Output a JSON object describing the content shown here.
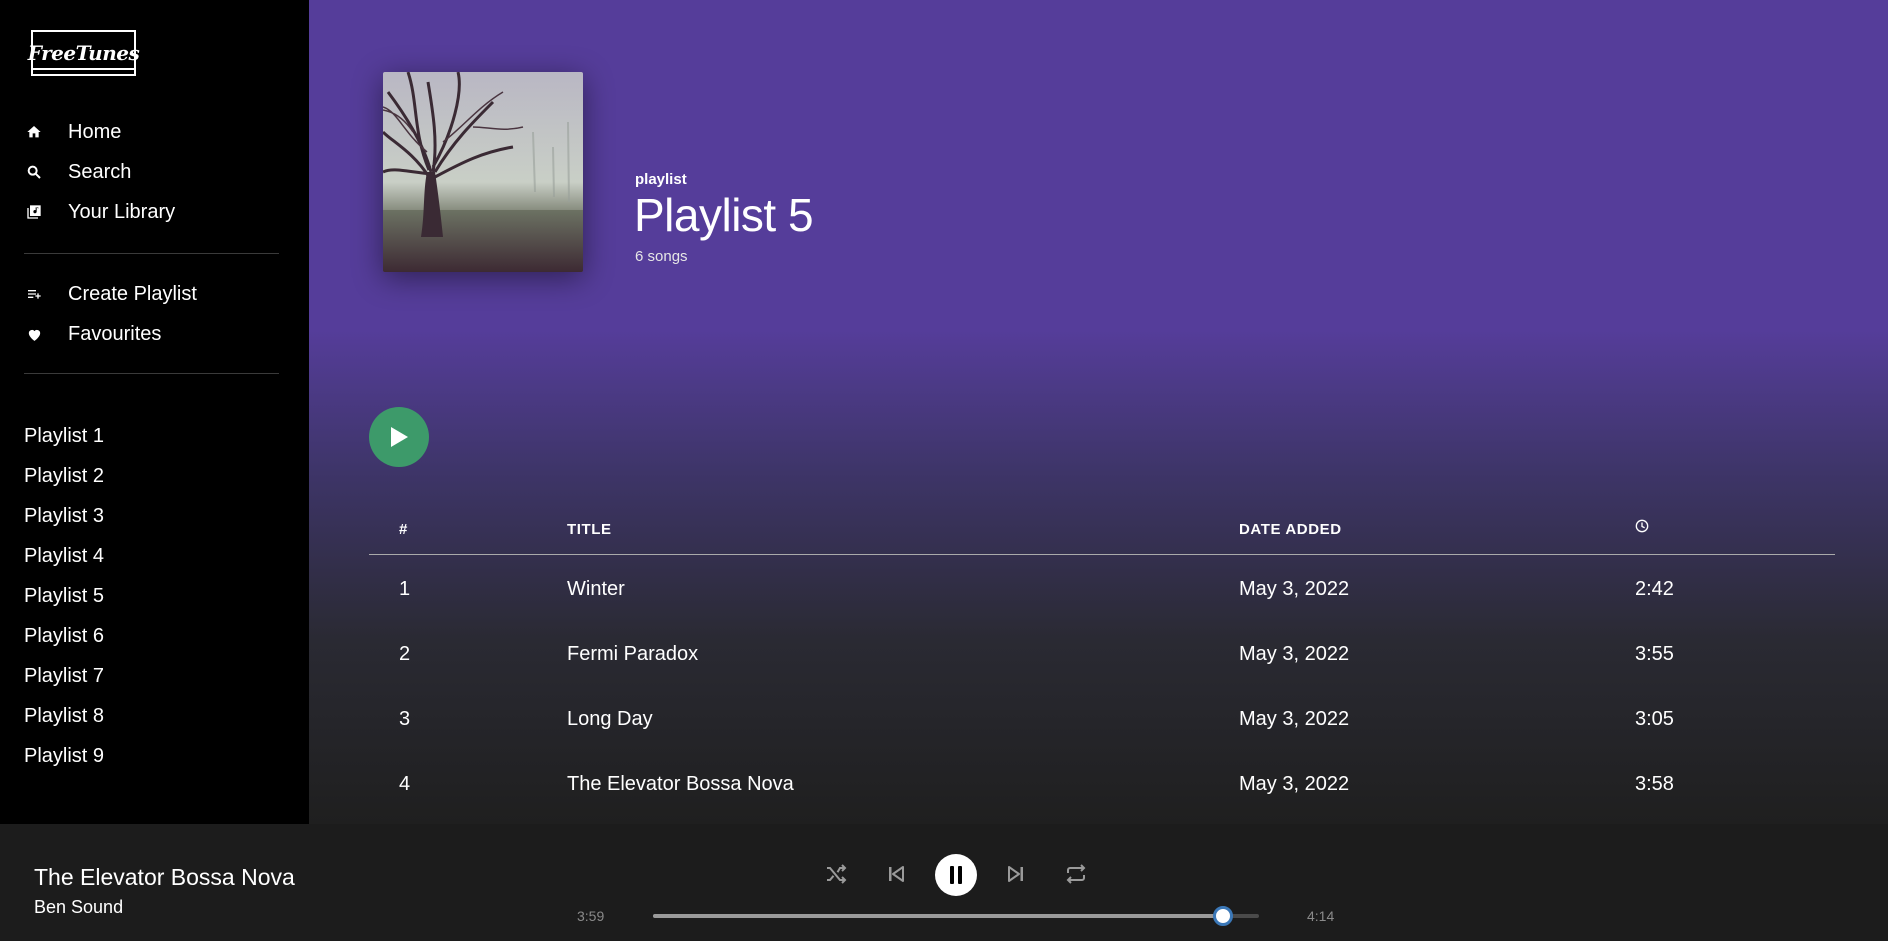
{
  "app": {
    "logo_text": "FreeTunes"
  },
  "nav": {
    "items": [
      {
        "label": "Home",
        "icon": "home-icon"
      },
      {
        "label": "Search",
        "icon": "search-icon"
      },
      {
        "label": "Your Library",
        "icon": "library-icon"
      }
    ],
    "actions": [
      {
        "label": "Create Playlist",
        "icon": "playlist-add-icon"
      },
      {
        "label": "Favourites",
        "icon": "heart-icon"
      }
    ],
    "playlists": [
      "Playlist 1",
      "Playlist 2",
      "Playlist 3",
      "Playlist 4",
      "Playlist 5",
      "Playlist 6",
      "Playlist 7",
      "Playlist 8",
      "Playlist 9"
    ]
  },
  "playlist": {
    "type_label": "playlist",
    "title": "Playlist 5",
    "song_count": "6 songs"
  },
  "table": {
    "headers": {
      "index": "#",
      "title": "TITLE",
      "date_added": "DATE ADDED",
      "duration_icon": "clock-icon"
    },
    "rows": [
      {
        "index": "1",
        "title": "Winter",
        "date_added": "May 3, 2022",
        "duration": "2:42"
      },
      {
        "index": "2",
        "title": "Fermi Paradox",
        "date_added": "May 3, 2022",
        "duration": "3:55"
      },
      {
        "index": "3",
        "title": "Long Day",
        "date_added": "May 3, 2022",
        "duration": "3:05"
      },
      {
        "index": "4",
        "title": "The Elevator Bossa Nova",
        "date_added": "May 3, 2022",
        "duration": "3:58"
      }
    ]
  },
  "player": {
    "now_playing_title": "The Elevator Bossa Nova",
    "now_playing_artist": "Ben Sound",
    "elapsed": "3:59",
    "total": "4:14",
    "progress_fraction": 0.94,
    "state": "playing",
    "controls": [
      "shuffle-icon",
      "previous-icon",
      "pause-icon",
      "next-icon",
      "repeat-icon"
    ]
  },
  "colors": {
    "header_purple": "#553d9a",
    "play_green": "#3d9a6a",
    "slider_thumb_border": "#3b78b8"
  }
}
